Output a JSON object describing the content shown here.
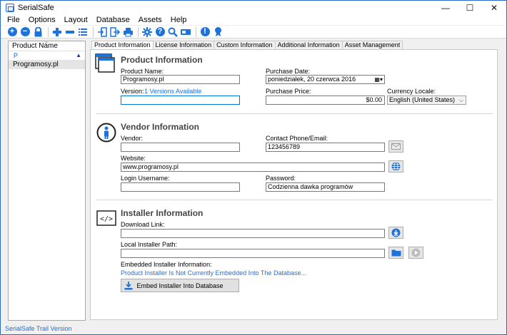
{
  "window": {
    "title": "SerialSafe",
    "minimize": "—",
    "maximize": "☐",
    "close": "✕"
  },
  "menu": [
    "File",
    "Options",
    "Layout",
    "Database",
    "Assets",
    "Help"
  ],
  "toolbar": {
    "icons": [
      "add-icon",
      "remove-icon",
      "lock-icon",
      "plus-icon",
      "minus-icon",
      "list-icon",
      "import-icon",
      "export-icon",
      "printer-icon",
      "settings-icon",
      "help-icon",
      "search-icon",
      "device-icon",
      "info-icon",
      "badge-icon"
    ]
  },
  "left_panel": {
    "column_header": "Product Name",
    "filter_value": "P",
    "rows": [
      "Programosy.pl"
    ]
  },
  "tabs": [
    {
      "label": "Product Information",
      "active": true
    },
    {
      "label": "License Information",
      "active": false
    },
    {
      "label": "Custom Information",
      "active": false
    },
    {
      "label": "Additional Information",
      "active": false
    },
    {
      "label": "Asset Management",
      "active": false
    }
  ],
  "product": {
    "section_title": "Product Information",
    "product_name_label": "Product Name:",
    "product_name_value": "Programosy.pl",
    "purchase_date_label": "Purchase Date:",
    "purchase_date_value": "poniedziałek, 20    czerwca    2016",
    "version_label": "Version:",
    "versions_link": "1 Versions Available",
    "version_value": "",
    "purchase_price_label": "Purchase Price:",
    "purchase_price_value": "$0.00",
    "currency_locale_label": "Currency Locale:",
    "currency_locale_value": "English (United States)"
  },
  "vendor": {
    "section_title": "Vendor Information",
    "vendor_label": "Vendor:",
    "vendor_value": "",
    "contact_label": "Contact Phone/Email:",
    "contact_value": "123456789",
    "website_label": "Website:",
    "website_value": "www.programosy.pl",
    "login_label": "Login Username:",
    "login_value": "",
    "password_label": "Password:",
    "password_value": "Codzienna dawka programów"
  },
  "installer": {
    "section_title": "Installer Information",
    "download_label": "Download Link:",
    "download_value": "",
    "local_path_label": "Local Installer Path:",
    "local_path_value": "",
    "embedded_label": "Embedded Installer Information:",
    "embedded_status": "Product Installer Is Not Currently Embedded Into The Database...",
    "embed_button": "Embed Installer Into Database"
  },
  "status": {
    "text": "SerialSafe Trail Version"
  },
  "colors": {
    "accent": "#1e73d9",
    "link": "#1f6fd6",
    "frame": "#0a4fb0"
  }
}
